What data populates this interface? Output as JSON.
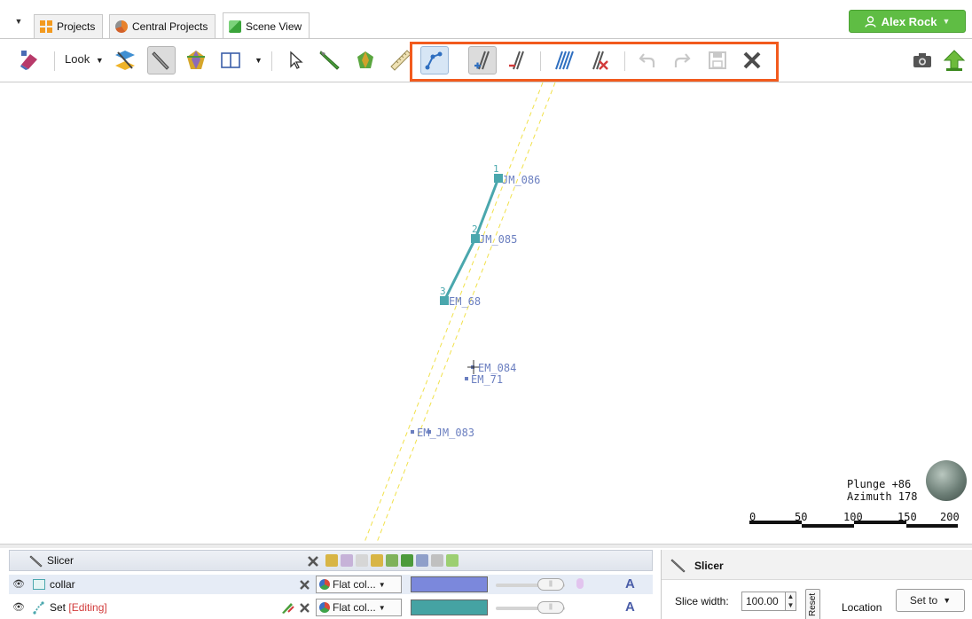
{
  "tabs": {
    "menu_glyph": "▼",
    "items": [
      {
        "label": "Projects",
        "icon": "projects-grid-icon",
        "active": false
      },
      {
        "label": "Central Projects",
        "icon": "central-projects-icon",
        "active": false
      },
      {
        "label": "Scene View",
        "icon": "scene-view-cube-icon",
        "active": true
      }
    ]
  },
  "user": {
    "name": "Alex Rock",
    "color": "#5fbd44"
  },
  "toolbar": {
    "look_label": "Look",
    "highlight_color": "#f25a1d",
    "tools": [
      "eraser-tool-icon",
      "look-dropdown",
      "slicer-toggle-icon",
      "slicer-pen-icon",
      "gem-icon",
      "split-view-icon",
      "select-pointer-icon",
      "draw-pen-icon",
      "polyline-icon",
      "ruler-icon",
      "new-polyline-icon",
      "add-to-set-icon",
      "remove-from-set-icon",
      "multi-select-icon",
      "remove-selection-icon",
      "undo-icon",
      "redo-icon",
      "save-icon",
      "close-edit-icon",
      "camera-icon",
      "share-icon"
    ]
  },
  "scene": {
    "points": [
      {
        "num": "1",
        "label": "JM_086"
      },
      {
        "num": "2",
        "label": "JM_085"
      },
      {
        "num": "3",
        "label": "EM_68"
      }
    ],
    "other_labels": [
      "EM_084",
      "EM_71",
      "EM_JM_083"
    ],
    "orientation": {
      "plunge": "Plunge +86",
      "azimuth": "Azimuth 178"
    },
    "scale_ticks": [
      "0",
      "50",
      "100",
      "150",
      "200"
    ],
    "polyline_color": "#4aa7ad",
    "slice_line_color": "#f1e14a"
  },
  "bottom_panel": {
    "header_title": "Slicer",
    "rows": [
      {
        "label": "collar",
        "status": "",
        "style": "Flat col...",
        "swatch_color": "#7b88dc"
      },
      {
        "label": "Set",
        "status": "[Editing]",
        "style": "Flat col...",
        "swatch_color": "#45a3a3"
      }
    ]
  },
  "slicer_panel": {
    "title": "Slicer",
    "slice_width_label": "Slice width:",
    "slice_width_value": "100.00",
    "reset_label": "Reset",
    "location_label": "Location",
    "set_to_label": "Set to"
  }
}
